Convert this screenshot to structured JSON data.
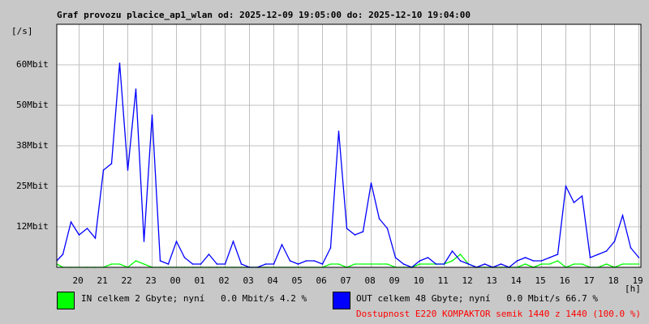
{
  "chart_data": {
    "type": "line",
    "title": "Graf provozu placice_ap1_wlan od: 2025-12-09 19:05:00 do: 2025-12-10 19:04:00",
    "ylabel": "[/s]",
    "xlabel": "[h]",
    "ylim_mbit": [
      0,
      75
    ],
    "y_ticks": [
      {
        "v": 12.5,
        "label": "12Mbit"
      },
      {
        "v": 25,
        "label": "25Mbit"
      },
      {
        "v": 37.5,
        "label": "38Mbit"
      },
      {
        "v": 50,
        "label": "50Mbit"
      },
      {
        "v": 62.5,
        "label": "60Mbit"
      }
    ],
    "x_ticks": [
      "20",
      "21",
      "22",
      "23",
      "00",
      "01",
      "02",
      "03",
      "04",
      "05",
      "06",
      "07",
      "08",
      "09",
      "10",
      "11",
      "12",
      "13",
      "14",
      "15",
      "16",
      "17",
      "18",
      "19"
    ],
    "grid": true,
    "x_start": "19:00",
    "x_step_minutes": 20,
    "series": [
      {
        "name": "OUT",
        "color": "#0000ff",
        "values": [
          2,
          4,
          14,
          10,
          12,
          9,
          30,
          32,
          63,
          30,
          55,
          8,
          47,
          2,
          1,
          8,
          3,
          1,
          1,
          4,
          1,
          1,
          8,
          1,
          0,
          0,
          1,
          1,
          7,
          2,
          1,
          2,
          2,
          1,
          6,
          42,
          12,
          10,
          11,
          26,
          15,
          12,
          3,
          1,
          0,
          2,
          3,
          1,
          1,
          5,
          2,
          1,
          0,
          1,
          0,
          1,
          0,
          2,
          3,
          2,
          2,
          3,
          4,
          25,
          20,
          22,
          3,
          4,
          5,
          8,
          16,
          6,
          3
        ]
      },
      {
        "name": "IN",
        "color": "#00ff00",
        "values": [
          1,
          0,
          0,
          0,
          0,
          0,
          0,
          1,
          1,
          0,
          2,
          1,
          0,
          0,
          0,
          0,
          0,
          0,
          0,
          0,
          0,
          0,
          0,
          0,
          0,
          0,
          0,
          0,
          0,
          0,
          0,
          0,
          0,
          0,
          1,
          1,
          0,
          1,
          1,
          1,
          1,
          1,
          0,
          0,
          0,
          1,
          1,
          1,
          1,
          2,
          4,
          1,
          0,
          0,
          0,
          0,
          0,
          0,
          1,
          0,
          1,
          1,
          2,
          0,
          1,
          1,
          0,
          0,
          1,
          0,
          1,
          1,
          1
        ]
      }
    ]
  },
  "legend": {
    "in": {
      "label": "IN celkem 2 Gbyte; nyní   0.0 Mbit/s 4.2 %",
      "color": "#00ff00"
    },
    "out": {
      "label": "OUT celkem 48 Gbyte; nyní   0.0 Mbit/s 66.7 %",
      "color": "#0000ff"
    },
    "availability": "Dostupnost E220 KOMPAKTOR semik 1440 z 1440 (100.0 %)"
  }
}
